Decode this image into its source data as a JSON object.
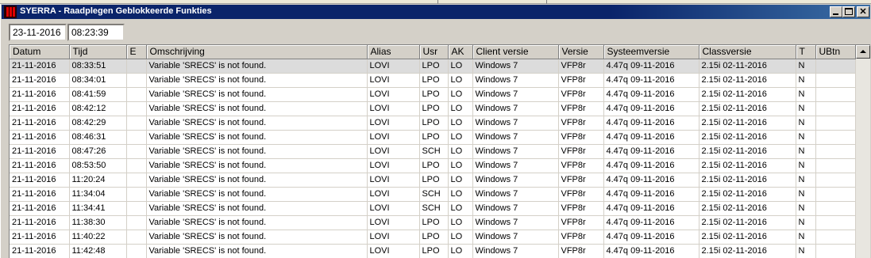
{
  "window": {
    "title": "SYERRA - Raadplegen Geblokkeerde Funkties"
  },
  "filters": {
    "date": "23-11-2016",
    "time": "08:23:39"
  },
  "table": {
    "columns": [
      "Datum",
      "Tijd",
      "E",
      "Omschrijving",
      "Alias",
      "Usr",
      "AK",
      "Client versie",
      "Versie",
      "Systeemversie",
      "Classversie",
      "T",
      "UBtn"
    ],
    "rows": [
      [
        "21-11-2016",
        "08:33:51",
        "",
        "Variable 'SRECS' is not found.",
        "LOVI",
        "LPO",
        "LO",
        "Windows 7",
        "VFP8r",
        "4.47q 09-11-2016",
        "2.15i 02-11-2016",
        "N",
        ""
      ],
      [
        "21-11-2016",
        "08:34:01",
        "",
        "Variable 'SRECS' is not found.",
        "LOVI",
        "LPO",
        "LO",
        "Windows 7",
        "VFP8r",
        "4.47q 09-11-2016",
        "2.15i 02-11-2016",
        "N",
        ""
      ],
      [
        "21-11-2016",
        "08:41:59",
        "",
        "Variable 'SRECS' is not found.",
        "LOVI",
        "LPO",
        "LO",
        "Windows 7",
        "VFP8r",
        "4.47q 09-11-2016",
        "2.15i 02-11-2016",
        "N",
        ""
      ],
      [
        "21-11-2016",
        "08:42:12",
        "",
        "Variable 'SRECS' is not found.",
        "LOVI",
        "LPO",
        "LO",
        "Windows 7",
        "VFP8r",
        "4.47q 09-11-2016",
        "2.15i 02-11-2016",
        "N",
        ""
      ],
      [
        "21-11-2016",
        "08:42:29",
        "",
        "Variable 'SRECS' is not found.",
        "LOVI",
        "LPO",
        "LO",
        "Windows 7",
        "VFP8r",
        "4.47q 09-11-2016",
        "2.15i 02-11-2016",
        "N",
        ""
      ],
      [
        "21-11-2016",
        "08:46:31",
        "",
        "Variable 'SRECS' is not found.",
        "LOVI",
        "LPO",
        "LO",
        "Windows 7",
        "VFP8r",
        "4.47q 09-11-2016",
        "2.15i 02-11-2016",
        "N",
        ""
      ],
      [
        "21-11-2016",
        "08:47:26",
        "",
        "Variable 'SRECS' is not found.",
        "LOVI",
        "SCH",
        "LO",
        "Windows 7",
        "VFP8r",
        "4.47q 09-11-2016",
        "2.15i 02-11-2016",
        "N",
        ""
      ],
      [
        "21-11-2016",
        "08:53:50",
        "",
        "Variable 'SRECS' is not found.",
        "LOVI",
        "LPO",
        "LO",
        "Windows 7",
        "VFP8r",
        "4.47q 09-11-2016",
        "2.15i 02-11-2016",
        "N",
        ""
      ],
      [
        "21-11-2016",
        "11:20:24",
        "",
        "Variable 'SRECS' is not found.",
        "LOVI",
        "LPO",
        "LO",
        "Windows 7",
        "VFP8r",
        "4.47q 09-11-2016",
        "2.15i 02-11-2016",
        "N",
        ""
      ],
      [
        "21-11-2016",
        "11:34:04",
        "",
        "Variable 'SRECS' is not found.",
        "LOVI",
        "SCH",
        "LO",
        "Windows 7",
        "VFP8r",
        "4.47q 09-11-2016",
        "2.15i 02-11-2016",
        "N",
        ""
      ],
      [
        "21-11-2016",
        "11:34:41",
        "",
        "Variable 'SRECS' is not found.",
        "LOVI",
        "SCH",
        "LO",
        "Windows 7",
        "VFP8r",
        "4.47q 09-11-2016",
        "2.15i 02-11-2016",
        "N",
        ""
      ],
      [
        "21-11-2016",
        "11:38:30",
        "",
        "Variable 'SRECS' is not found.",
        "LOVI",
        "LPO",
        "LO",
        "Windows 7",
        "VFP8r",
        "4.47q 09-11-2016",
        "2.15i 02-11-2016",
        "N",
        ""
      ],
      [
        "21-11-2016",
        "11:40:22",
        "",
        "Variable 'SRECS' is not found.",
        "LOVI",
        "LPO",
        "LO",
        "Windows 7",
        "VFP8r",
        "4.47q 09-11-2016",
        "2.15i 02-11-2016",
        "N",
        ""
      ],
      [
        "21-11-2016",
        "11:42:48",
        "",
        "Variable 'SRECS' is not found.",
        "LOVI",
        "LPO",
        "LO",
        "Windows 7",
        "VFP8r",
        "4.47q 09-11-2016",
        "2.15i 02-11-2016",
        "N",
        ""
      ]
    ]
  },
  "icons": {
    "app": "syerra-app-icon",
    "minimize": "minimize-icon",
    "maximize": "maximize-icon",
    "close": "close-icon",
    "scroll_up": "scroll-up-arrow-icon"
  },
  "colors": {
    "titlebar": "#0a246a",
    "selected_row": "#dcdcdc",
    "app_icon_bars": "#e00000"
  }
}
